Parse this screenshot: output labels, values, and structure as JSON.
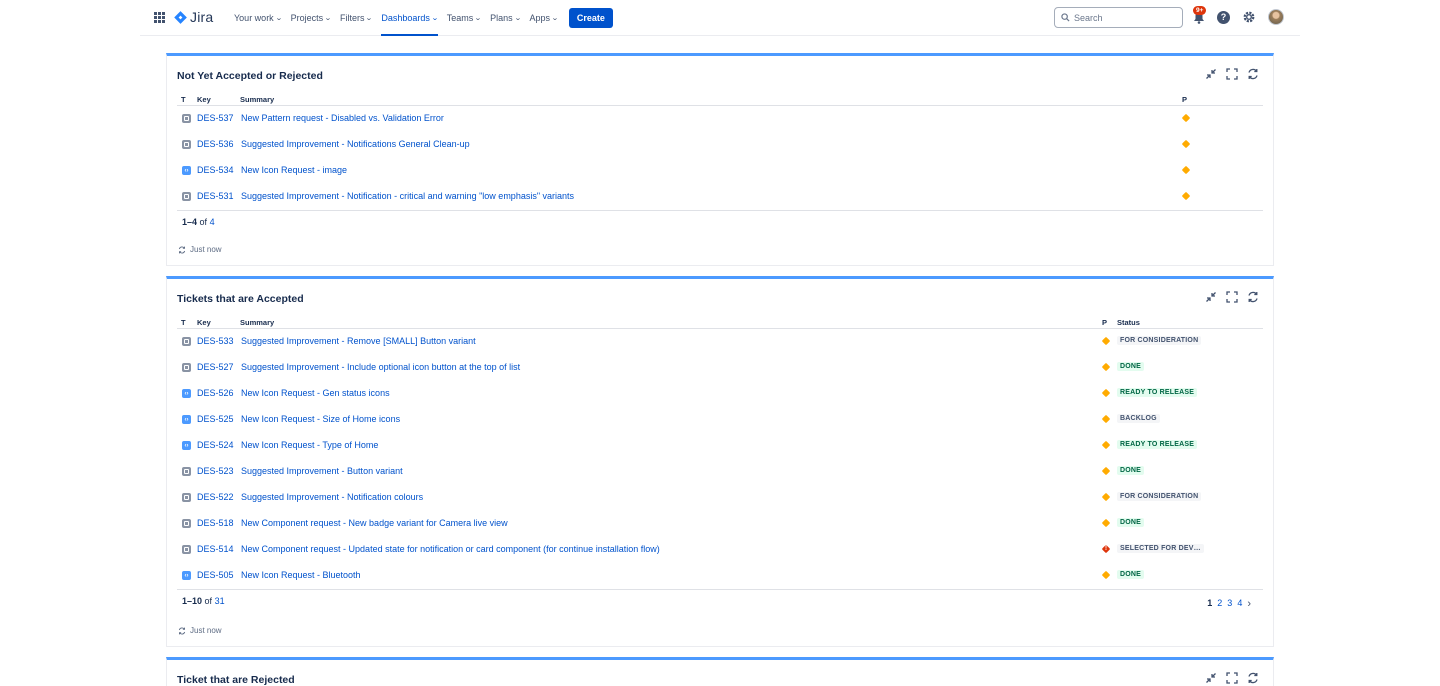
{
  "nav": {
    "product": "Jira",
    "items": [
      {
        "label": "Your work",
        "active": false
      },
      {
        "label": "Projects",
        "active": false
      },
      {
        "label": "Filters",
        "active": false
      },
      {
        "label": "Dashboards",
        "active": true
      },
      {
        "label": "Teams",
        "active": false
      },
      {
        "label": "Plans",
        "active": false
      },
      {
        "label": "Apps",
        "active": false
      }
    ],
    "create_label": "Create",
    "search_placeholder": "Search",
    "notifications_badge": "9+",
    "help_glyph": "?"
  },
  "gadgets": [
    {
      "title": "Not Yet Accepted or Rejected",
      "columns": {
        "type": "T",
        "key": "Key",
        "summary": "Summary",
        "priority": "P"
      },
      "rows": [
        {
          "type": "task",
          "key": "DES-537",
          "summary": "New Pattern request - Disabled vs. Validation Error",
          "priority": "medium"
        },
        {
          "type": "task",
          "key": "DES-536",
          "summary": "Suggested Improvement - Notifications General Clean-up",
          "priority": "medium"
        },
        {
          "type": "icon",
          "key": "DES-534",
          "summary": "New Icon Request - image",
          "priority": "medium"
        },
        {
          "type": "task",
          "key": "DES-531",
          "summary": "Suggested Improvement - Notification - critical and warning \"low emphasis\" variants",
          "priority": "medium"
        }
      ],
      "range": "1–4",
      "of": "of",
      "total": "4",
      "refreshed": "Just now"
    },
    {
      "title": "Tickets that are Accepted",
      "columns": {
        "type": "T",
        "key": "Key",
        "summary": "Summary",
        "priority": "P",
        "status": "Status"
      },
      "rows": [
        {
          "type": "task",
          "key": "DES-533",
          "summary": "Suggested Improvement - Remove [SMALL] Button variant",
          "priority": "medium",
          "status": "FOR CONSIDERATION",
          "status_color": "grey"
        },
        {
          "type": "task",
          "key": "DES-527",
          "summary": "Suggested Improvement - Include optional icon button at the top of list",
          "priority": "medium",
          "status": "DONE",
          "status_color": "green"
        },
        {
          "type": "icon",
          "key": "DES-526",
          "summary": "New Icon Request - Gen status icons",
          "priority": "medium",
          "status": "READY TO RELEASE",
          "status_color": "green"
        },
        {
          "type": "icon",
          "key": "DES-525",
          "summary": "New Icon Request - Size of Home icons",
          "priority": "medium",
          "status": "BACKLOG",
          "status_color": "grey"
        },
        {
          "type": "icon",
          "key": "DES-524",
          "summary": "New Icon Request - Type of Home",
          "priority": "medium",
          "status": "READY TO RELEASE",
          "status_color": "green"
        },
        {
          "type": "task",
          "key": "DES-523",
          "summary": "Suggested Improvement - Button variant",
          "priority": "medium",
          "status": "DONE",
          "status_color": "green"
        },
        {
          "type": "task",
          "key": "DES-522",
          "summary": "Suggested Improvement - Notification colours",
          "priority": "medium",
          "status": "FOR CONSIDERATION",
          "status_color": "grey"
        },
        {
          "type": "task",
          "key": "DES-518",
          "summary": "New Component request - New badge variant for Camera live view",
          "priority": "medium",
          "status": "DONE",
          "status_color": "green"
        },
        {
          "type": "task",
          "key": "DES-514",
          "summary": "New Component request - Updated state for notification or card component (for continue installation flow)",
          "priority": "highest",
          "status": "SELECTED FOR DEV…",
          "status_color": "grey"
        },
        {
          "type": "icon",
          "key": "DES-505",
          "summary": "New Icon Request - Bluetooth",
          "priority": "medium",
          "status": "DONE",
          "status_color": "green"
        }
      ],
      "range": "1–10",
      "of": "of",
      "total": "31",
      "pages": [
        "1",
        "2",
        "3",
        "4"
      ],
      "current_page": "1",
      "next_glyph": "›",
      "refreshed": "Just now"
    },
    {
      "title": "Ticket that are Rejected"
    }
  ],
  "colors": {
    "brand": "#0052cc",
    "gadget_top": "#4c9aff",
    "priority_medium": "#ffab00",
    "priority_highest": "#de350b",
    "status_done_bg": "#e3fcef",
    "status_done_fg": "#006644"
  },
  "icons": {
    "app_switcher": "grid-icon",
    "minimize": "minimize-icon",
    "fullscreen": "fullscreen-icon",
    "refresh": "refresh-icon",
    "notifications": "bell-icon",
    "help": "help-icon",
    "settings": "gear-icon"
  }
}
